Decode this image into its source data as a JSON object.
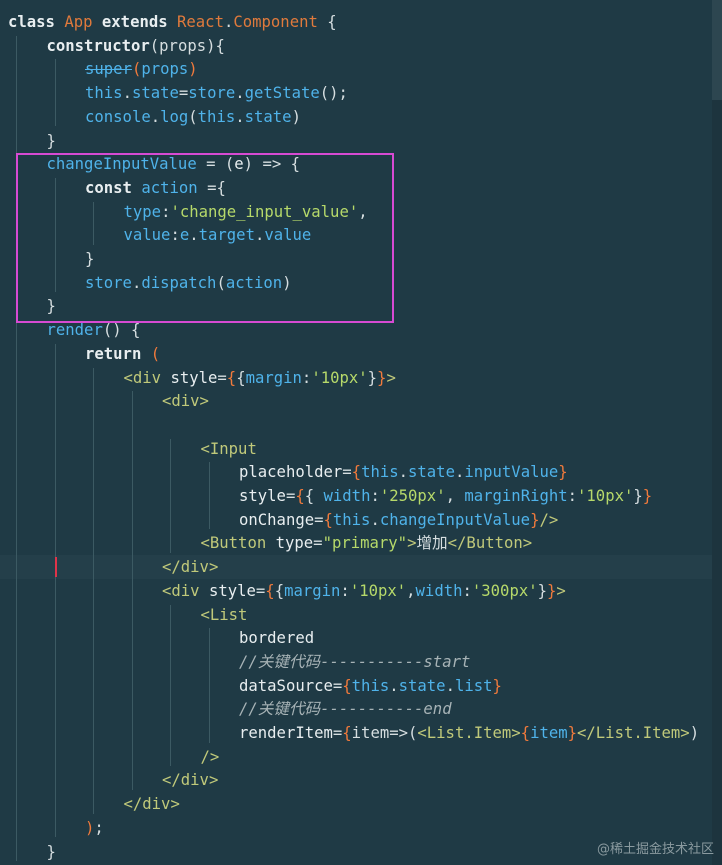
{
  "editor": {
    "lines": [
      {
        "indent": 0,
        "tokens": [
          [
            "kw",
            "class "
          ],
          [
            "cls",
            "App "
          ],
          [
            "kw",
            "extends "
          ],
          [
            "cls",
            "React"
          ],
          [
            "plain",
            "."
          ],
          [
            "cls",
            "Component"
          ],
          [
            "plain",
            " {"
          ]
        ]
      },
      {
        "indent": 1,
        "tokens": [
          [
            "kw",
            "constructor"
          ],
          [
            "plain",
            "(props){"
          ]
        ]
      },
      {
        "indent": 2,
        "tokens": [
          [
            "strike",
            "super"
          ],
          [
            "br",
            "("
          ],
          [
            "fn",
            "props"
          ],
          [
            "br",
            ")"
          ]
        ]
      },
      {
        "indent": 2,
        "tokens": [
          [
            "th",
            "this"
          ],
          [
            "plain",
            "."
          ],
          [
            "prop",
            "state"
          ],
          [
            "plain",
            "="
          ],
          [
            "fn",
            "store"
          ],
          [
            "plain",
            "."
          ],
          [
            "fn",
            "getState"
          ],
          [
            "plain",
            "();"
          ]
        ]
      },
      {
        "indent": 2,
        "tokens": [
          [
            "fn",
            "console"
          ],
          [
            "plain",
            "."
          ],
          [
            "fn",
            "log"
          ],
          [
            "plain",
            "("
          ],
          [
            "th",
            "this"
          ],
          [
            "plain",
            "."
          ],
          [
            "prop",
            "state"
          ],
          [
            "plain",
            ")"
          ]
        ]
      },
      {
        "indent": 1,
        "tokens": [
          [
            "plain",
            "}"
          ]
        ]
      },
      {
        "indent": 1,
        "tokens": [
          [
            "fn",
            "changeInputValue"
          ],
          [
            "plain",
            " = ("
          ],
          [
            "param",
            "e"
          ],
          [
            "plain",
            ") => {"
          ]
        ]
      },
      {
        "indent": 2,
        "tokens": [
          [
            "kw",
            "const "
          ],
          [
            "fn",
            "action"
          ],
          [
            "plain",
            " ={"
          ]
        ]
      },
      {
        "indent": 3,
        "tokens": [
          [
            "prop",
            "type"
          ],
          [
            "plain",
            ":"
          ],
          [
            "str",
            "'change_input_value'"
          ],
          [
            "plain",
            ","
          ]
        ]
      },
      {
        "indent": 3,
        "tokens": [
          [
            "prop",
            "value"
          ],
          [
            "plain",
            ":"
          ],
          [
            "fn",
            "e"
          ],
          [
            "plain",
            "."
          ],
          [
            "prop",
            "target"
          ],
          [
            "plain",
            "."
          ],
          [
            "prop",
            "value"
          ]
        ]
      },
      {
        "indent": 2,
        "tokens": [
          [
            "plain",
            "}"
          ]
        ]
      },
      {
        "indent": 2,
        "tokens": [
          [
            "fn",
            "store"
          ],
          [
            "plain",
            "."
          ],
          [
            "fn",
            "dispatch"
          ],
          [
            "plain",
            "("
          ],
          [
            "fn",
            "action"
          ],
          [
            "plain",
            ")"
          ]
        ]
      },
      {
        "indent": 1,
        "tokens": [
          [
            "plain",
            "}"
          ]
        ]
      },
      {
        "indent": 1,
        "tokens": [
          [
            "fn",
            "render"
          ],
          [
            "plain",
            "() {"
          ]
        ]
      },
      {
        "indent": 2,
        "tokens": [
          [
            "kw",
            "return "
          ],
          [
            "br",
            "("
          ]
        ]
      },
      {
        "indent": 3,
        "tokens": [
          [
            "tag",
            "<div "
          ],
          [
            "attr",
            "style"
          ],
          [
            "plain",
            "="
          ],
          [
            "br",
            "{"
          ],
          [
            "plain",
            "{"
          ],
          [
            "prop",
            "margin"
          ],
          [
            "plain",
            ":"
          ],
          [
            "str",
            "'10px'"
          ],
          [
            "plain",
            "}"
          ],
          [
            "br",
            "}"
          ],
          [
            "tag",
            ">"
          ]
        ]
      },
      {
        "indent": 4,
        "tokens": [
          [
            "tag",
            "<div>"
          ]
        ]
      },
      {
        "indent": 4,
        "tokens": []
      },
      {
        "indent": 5,
        "tokens": [
          [
            "tag",
            "<Input"
          ]
        ]
      },
      {
        "indent": 6,
        "tokens": [
          [
            "attr",
            "placeholder"
          ],
          [
            "plain",
            "="
          ],
          [
            "br",
            "{"
          ],
          [
            "th",
            "this"
          ],
          [
            "plain",
            "."
          ],
          [
            "prop",
            "state"
          ],
          [
            "plain",
            "."
          ],
          [
            "prop",
            "inputValue"
          ],
          [
            "br",
            "}"
          ]
        ]
      },
      {
        "indent": 6,
        "tokens": [
          [
            "attr",
            "style"
          ],
          [
            "plain",
            "="
          ],
          [
            "br",
            "{"
          ],
          [
            "plain",
            "{ "
          ],
          [
            "prop",
            "width"
          ],
          [
            "plain",
            ":"
          ],
          [
            "str",
            "'250px'"
          ],
          [
            "plain",
            ", "
          ],
          [
            "prop",
            "marginRight"
          ],
          [
            "plain",
            ":"
          ],
          [
            "str",
            "'10px'"
          ],
          [
            "plain",
            "}"
          ],
          [
            "br",
            "}"
          ]
        ]
      },
      {
        "indent": 6,
        "tokens": [
          [
            "attr",
            "onChange"
          ],
          [
            "plain",
            "="
          ],
          [
            "br",
            "{"
          ],
          [
            "th",
            "this"
          ],
          [
            "plain",
            "."
          ],
          [
            "fn",
            "changeInputValue"
          ],
          [
            "br",
            "}"
          ],
          [
            "tag",
            "/>"
          ]
        ]
      },
      {
        "indent": 5,
        "tokens": [
          [
            "tag",
            "<Button "
          ],
          [
            "attr",
            "type"
          ],
          [
            "plain",
            "="
          ],
          [
            "str",
            "\"primary\""
          ],
          [
            "tag",
            ">"
          ],
          [
            "plain",
            "增加"
          ],
          [
            "tag",
            "</Button>"
          ]
        ]
      },
      {
        "indent": 4,
        "tokens": [
          [
            "tag",
            "</div>"
          ]
        ],
        "current": true
      },
      {
        "indent": 4,
        "tokens": [
          [
            "tag",
            "<div "
          ],
          [
            "attr",
            "style"
          ],
          [
            "plain",
            "="
          ],
          [
            "br",
            "{"
          ],
          [
            "plain",
            "{"
          ],
          [
            "prop",
            "margin"
          ],
          [
            "plain",
            ":"
          ],
          [
            "str",
            "'10px'"
          ],
          [
            "plain",
            ","
          ],
          [
            "prop",
            "width"
          ],
          [
            "plain",
            ":"
          ],
          [
            "str",
            "'300px'"
          ],
          [
            "plain",
            "}"
          ],
          [
            "br",
            "}"
          ],
          [
            "tag",
            ">"
          ]
        ]
      },
      {
        "indent": 5,
        "tokens": [
          [
            "tag",
            "<List"
          ]
        ]
      },
      {
        "indent": 6,
        "tokens": [
          [
            "attr",
            "bordered"
          ]
        ]
      },
      {
        "indent": 6,
        "tokens": [
          [
            "cm",
            "//关键代码-----------start"
          ]
        ]
      },
      {
        "indent": 6,
        "tokens": [
          [
            "attr",
            "dataSource"
          ],
          [
            "plain",
            "="
          ],
          [
            "br",
            "{"
          ],
          [
            "th",
            "this"
          ],
          [
            "plain",
            "."
          ],
          [
            "prop",
            "state"
          ],
          [
            "plain",
            "."
          ],
          [
            "prop",
            "list"
          ],
          [
            "br",
            "}"
          ]
        ]
      },
      {
        "indent": 6,
        "tokens": [
          [
            "cm",
            "//关键代码-----------end"
          ]
        ]
      },
      {
        "indent": 6,
        "tokens": [
          [
            "attr",
            "renderItem"
          ],
          [
            "plain",
            "="
          ],
          [
            "br",
            "{"
          ],
          [
            "plain",
            "item=>("
          ],
          [
            "tag",
            "<List.Item>"
          ],
          [
            "br",
            "{"
          ],
          [
            "prop",
            "item"
          ],
          [
            "br",
            "}"
          ],
          [
            "tag",
            "</List.Item>"
          ],
          [
            "plain",
            ")"
          ]
        ]
      },
      {
        "indent": 5,
        "tokens": [
          [
            "tag",
            "/>"
          ]
        ]
      },
      {
        "indent": 4,
        "tokens": [
          [
            "tag",
            "</div>"
          ]
        ]
      },
      {
        "indent": 3,
        "tokens": [
          [
            "tag",
            "</div>"
          ]
        ]
      },
      {
        "indent": 2,
        "tokens": [
          [
            "br",
            ")"
          ],
          [
            "plain",
            ";"
          ]
        ]
      },
      {
        "indent": 1,
        "tokens": [
          [
            "plain",
            "}"
          ]
        ]
      }
    ]
  },
  "watermark": "@稀土掘金技术社区"
}
